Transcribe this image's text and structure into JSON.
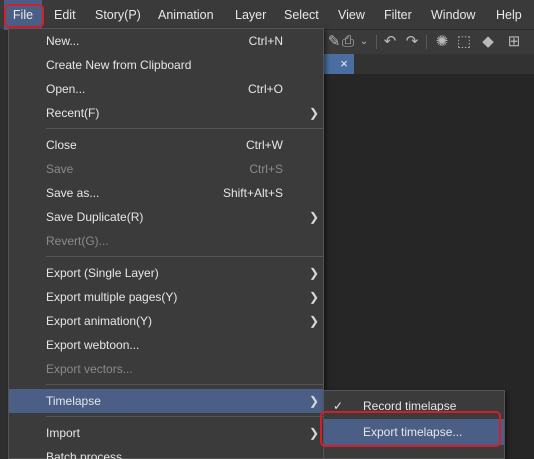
{
  "menubar": {
    "items": [
      "File",
      "Edit",
      "Story(P)",
      "Animation",
      "Layer",
      "Select",
      "View",
      "Filter",
      "Window",
      "Help"
    ]
  },
  "toolbar": {
    "icons": [
      "brush-icon",
      "bucket-icon",
      "chevron-down-icon",
      "undo-icon",
      "redo-icon",
      "spinner-icon",
      "marquee-icon",
      "fill-icon",
      "transform-icon"
    ]
  },
  "tab": {
    "close": "×"
  },
  "file_menu": {
    "items": [
      {
        "label": "New...",
        "shortcut": "Ctrl+N"
      },
      {
        "label": "Create New from Clipboard",
        "shortcut": ""
      },
      {
        "label": "Open...",
        "shortcut": "Ctrl+O"
      },
      {
        "label": "Recent(F)",
        "shortcut": ""
      },
      {
        "label": "Close",
        "shortcut": "Ctrl+W"
      },
      {
        "label": "Save",
        "shortcut": "Ctrl+S"
      },
      {
        "label": "Save as...",
        "shortcut": "Shift+Alt+S"
      },
      {
        "label": "Save Duplicate(R)",
        "shortcut": ""
      },
      {
        "label": "Revert(G)...",
        "shortcut": ""
      },
      {
        "label": "Export (Single Layer)",
        "shortcut": ""
      },
      {
        "label": "Export multiple pages(Y)",
        "shortcut": ""
      },
      {
        "label": "Export animation(Y)",
        "shortcut": ""
      },
      {
        "label": "Export webtoon...",
        "shortcut": ""
      },
      {
        "label": "Export vectors...",
        "shortcut": ""
      },
      {
        "label": "Timelapse",
        "shortcut": ""
      },
      {
        "label": "Import",
        "shortcut": ""
      },
      {
        "label": "Batch process",
        "shortcut": ""
      }
    ],
    "arrow": "❯"
  },
  "timelapse_submenu": {
    "items": [
      {
        "label": "Record timelapse",
        "check": "✓"
      },
      {
        "label": "Export timelapse...",
        "check": ""
      }
    ]
  },
  "colors": {
    "highlight": "#d21f2c",
    "selection": "#4a5e86",
    "menu_bg": "#3b3b3b"
  }
}
